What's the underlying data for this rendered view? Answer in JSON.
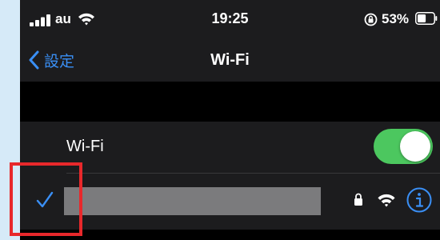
{
  "status_bar": {
    "carrier": "au",
    "time": "19:25",
    "battery_percent": "53%",
    "battery_level": 0.53
  },
  "nav": {
    "back_label": "設定",
    "title": "Wi-Fi"
  },
  "wifi_row": {
    "label": "Wi-Fi",
    "toggle_on": true
  },
  "connected_network": {
    "ssid": "",
    "secured": true,
    "connected": true
  },
  "colors": {
    "accent": "#3a8ff5",
    "toggle_on": "#4cc75f",
    "highlight": "#e8282b"
  },
  "icons": [
    "signal-bars-icon",
    "wifi-icon",
    "rotation-lock-icon",
    "battery-icon",
    "chevron-left-icon",
    "checkmark-icon",
    "lock-icon",
    "info-icon"
  ]
}
